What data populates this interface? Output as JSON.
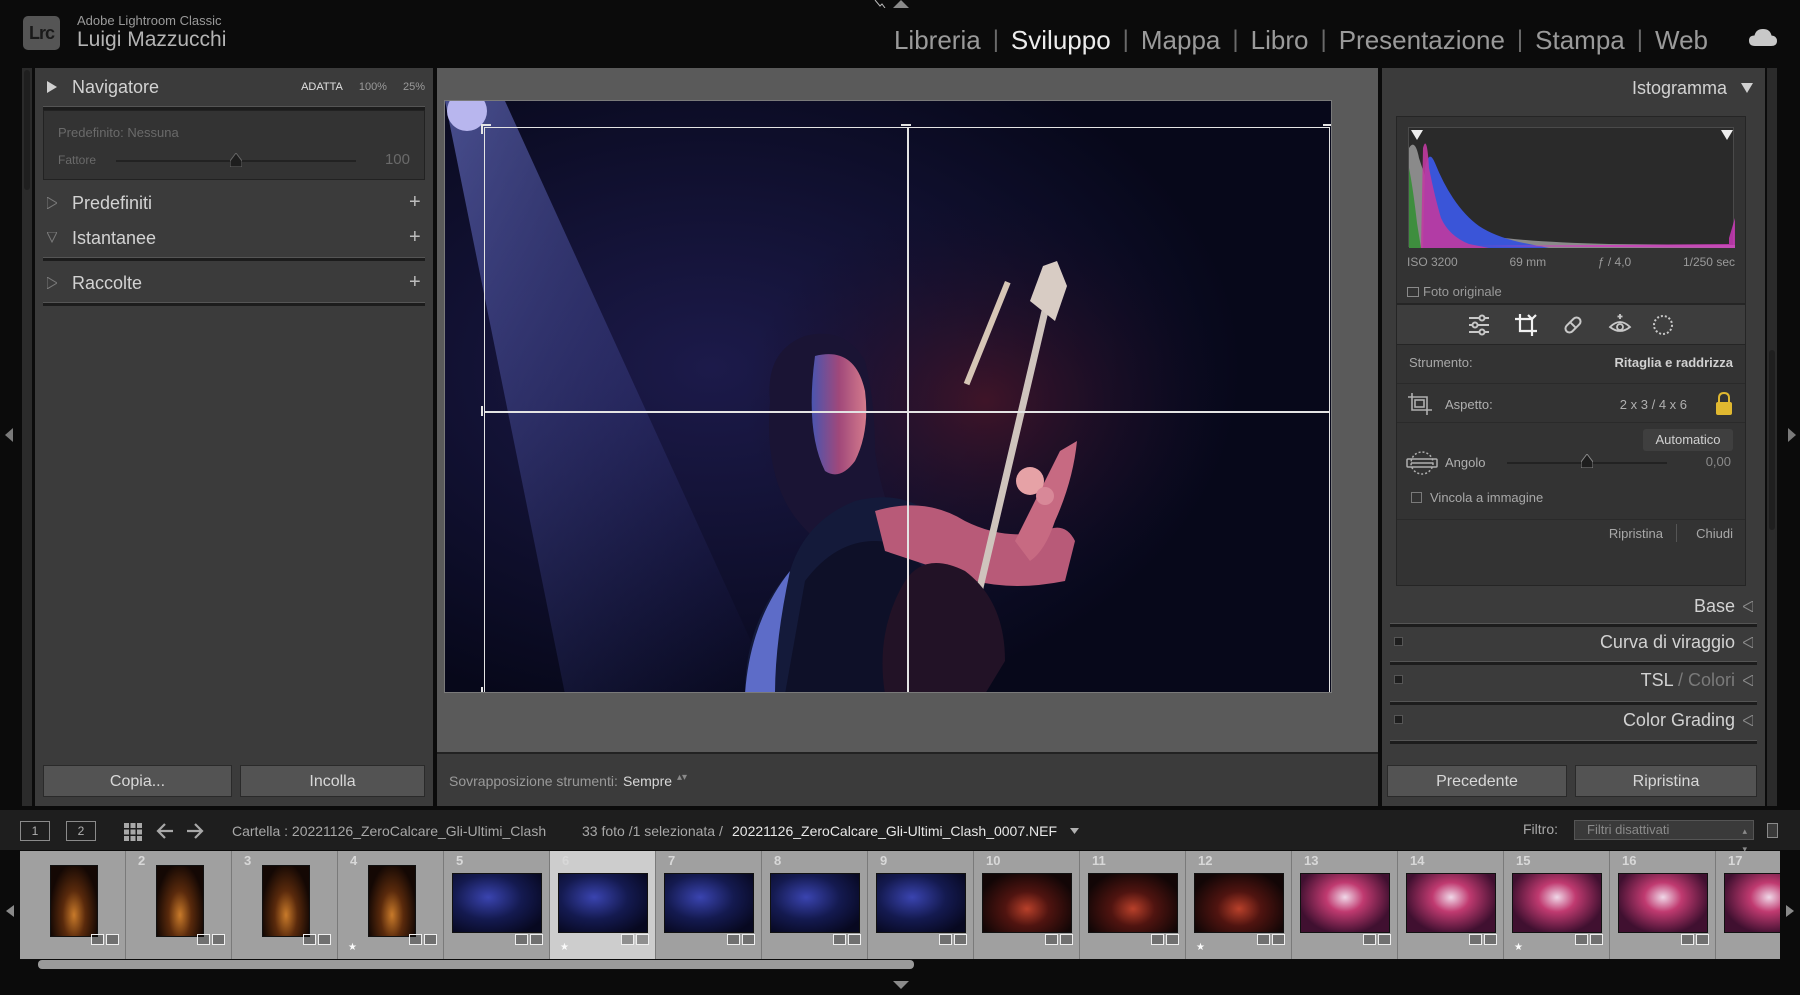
{
  "app": {
    "logo_text": "Lrc",
    "name": "Adobe Lightroom Classic",
    "user": "Luigi Mazzucchi"
  },
  "modules": [
    "Libreria",
    "Sviluppo",
    "Mappa",
    "Libro",
    "Presentazione",
    "Stampa",
    "Web"
  ],
  "active_module": "Sviluppo",
  "left_panel": {
    "navigator": {
      "title": "Navigatore",
      "modes": [
        "ADATTA",
        "100%",
        "25%"
      ],
      "preset_label": "Predefinito: Nessuna",
      "factor_label": "Fattore",
      "factor_value": "100"
    },
    "sections": [
      {
        "title": "Predefiniti"
      },
      {
        "title": "Istantanee"
      },
      {
        "title": "Raccolte"
      }
    ],
    "copy_button": "Copia...",
    "paste_button": "Incolla"
  },
  "center": {
    "overlay_label": "Sovrapposizione strumenti:",
    "overlay_value": "Sempre"
  },
  "right_panel": {
    "histogram": {
      "title": "Istogramma",
      "iso": "ISO 3200",
      "focal": "69 mm",
      "aperture": "ƒ / 4,0",
      "shutter": "1/250 sec",
      "original_photo": "Foto originale"
    },
    "tool": {
      "label": "Strumento:",
      "value": "Ritaglia e raddrizza",
      "aspect_label": "Aspetto:",
      "aspect_value": "2 x 3  /  4 x 6",
      "auto_button": "Automatico",
      "angle_label": "Angolo",
      "angle_value": "0,00",
      "constrain_label": "Vincola a immagine",
      "reset_link": "Ripristina",
      "close_link": "Chiudi"
    },
    "sections": [
      {
        "title": "Base"
      },
      {
        "title": "Curva di viraggio"
      },
      {
        "title": "TSL",
        "suffix": " / Colori"
      },
      {
        "title": "Color Grading"
      }
    ],
    "previous_button": "Precedente",
    "reset_button": "Ripristina"
  },
  "filmbar": {
    "monitor1": "1",
    "monitor2": "2",
    "folder": "Cartella : 20221126_ZeroCalcare_Gli-Ultimi_Clash",
    "count": "33 foto /1 selezionata /",
    "file": "20221126_ZeroCalcare_Gli-Ultimi_Clash_0007.NEF",
    "filter_label": "Filtro:",
    "filter_value": "Filtri disattivati"
  },
  "filmstrip": [
    {
      "num": "",
      "kind": "portrait",
      "star": false,
      "selected": false
    },
    {
      "num": "2",
      "kind": "portrait",
      "star": false,
      "selected": false
    },
    {
      "num": "3",
      "kind": "portrait",
      "star": false,
      "selected": false
    },
    {
      "num": "4",
      "kind": "portrait",
      "star": true,
      "selected": false
    },
    {
      "num": "5",
      "kind": "blue",
      "star": false,
      "selected": false
    },
    {
      "num": "6",
      "kind": "blue",
      "star": true,
      "selected": true
    },
    {
      "num": "7",
      "kind": "blue",
      "star": false,
      "selected": false
    },
    {
      "num": "8",
      "kind": "blue",
      "star": false,
      "selected": false
    },
    {
      "num": "9",
      "kind": "blue",
      "star": false,
      "selected": false
    },
    {
      "num": "10",
      "kind": "red",
      "star": false,
      "selected": false
    },
    {
      "num": "11",
      "kind": "red",
      "star": false,
      "selected": false
    },
    {
      "num": "12",
      "kind": "red",
      "star": true,
      "selected": false
    },
    {
      "num": "13",
      "kind": "crowd",
      "star": false,
      "selected": false
    },
    {
      "num": "14",
      "kind": "crowd",
      "star": false,
      "selected": false
    },
    {
      "num": "15",
      "kind": "crowd",
      "star": true,
      "selected": false
    },
    {
      "num": "16",
      "kind": "crowd",
      "star": false,
      "selected": false
    },
    {
      "num": "17",
      "kind": "crowd",
      "star": false,
      "selected": false
    }
  ]
}
